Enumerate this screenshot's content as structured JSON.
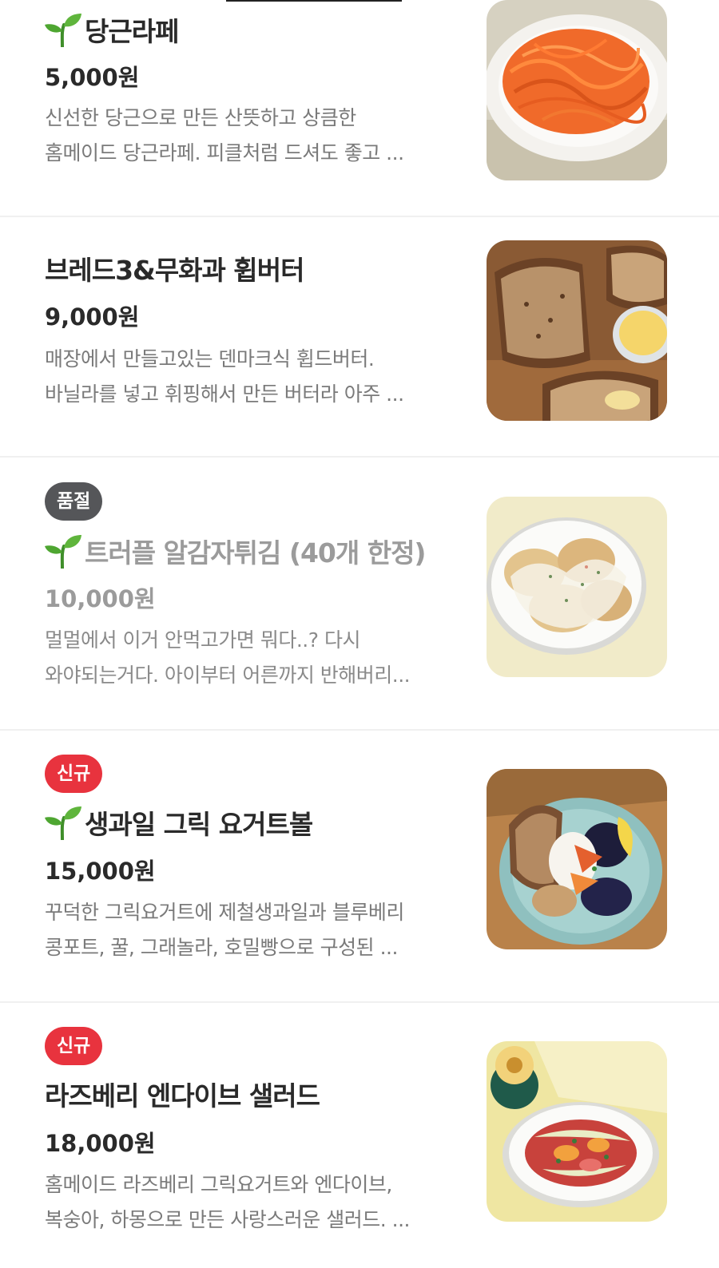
{
  "menu": {
    "items": [
      {
        "name": "당근라페",
        "price": "5,000원",
        "desc_line1": "신선한 당근으로 만든 산뜻하고 상큼한",
        "desc_line2": "홈메이드 당근라페. 피클처럼 드셔도 좋고 ...",
        "image_icon": "carrot-rapee-photo",
        "sprout_icon": "sprout-icon"
      },
      {
        "name": "브레드3&무화과 휩버터",
        "price": "9,000원",
        "desc_line1": "매장에서 만들고있는 덴마크식 휩드버터.",
        "desc_line2": "바닐라를 넣고 휘핑해서 만든 버터라 아주 ...",
        "image_icon": "bread-butter-photo"
      },
      {
        "badge": "품절",
        "name": "트러플 알감자튀김 (40개 한정)",
        "price": "10,000원",
        "desc_line1": "멀멀에서 이거 안먹고가면 뭐다..? 다시",
        "desc_line2": "와야되는거다. 아이부터 어른까지 반해버리...",
        "image_icon": "truffle-potato-photo",
        "sprout_icon": "sprout-icon"
      },
      {
        "badge": "신규",
        "name": "생과일 그릭 요거트볼",
        "price": "15,000원",
        "desc_line1": "꾸덕한 그릭요거트에 제철생과일과 블루베리",
        "desc_line2": "콩포트, 꿀, 그래놀라, 호밀빵으로 구성된 ...",
        "image_icon": "yogurt-bowl-photo",
        "sprout_icon": "sprout-icon"
      },
      {
        "badge": "신규",
        "name": "라즈베리 엔다이브 샐러드",
        "price": "18,000원",
        "desc_line1": "홈메이드 라즈베리 그릭요거트와 엔다이브,",
        "desc_line2": "복숭아, 하몽으로 만든 사랑스러운 샐러드. ...",
        "image_icon": "endive-salad-photo"
      }
    ]
  },
  "colors": {
    "badge_new": "#e8333e",
    "badge_soldout": "#555659",
    "title": "#2a2a2a",
    "description": "#7a7a7a",
    "divider": "#f0f0f0"
  }
}
